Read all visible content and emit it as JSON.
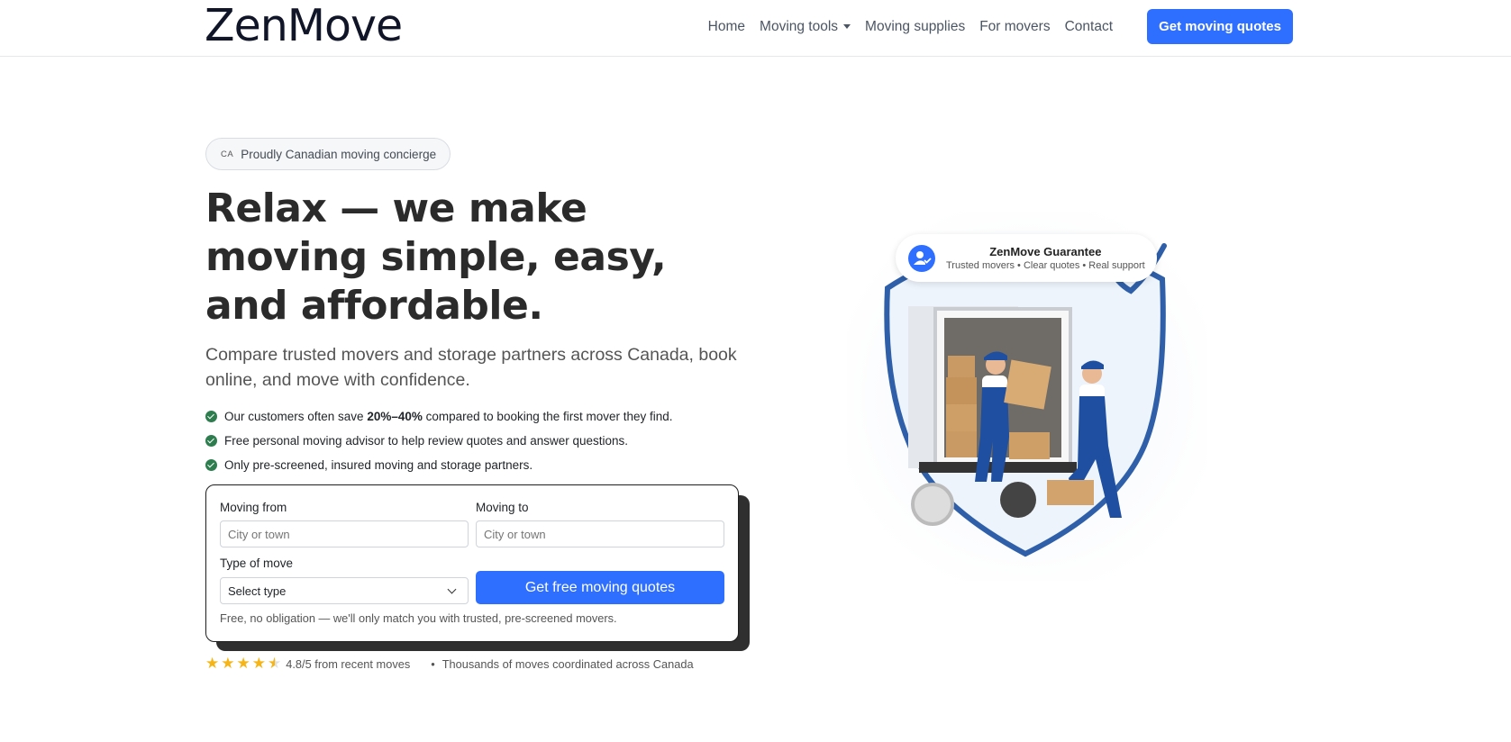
{
  "brand": {
    "name": "ZenMove"
  },
  "nav": {
    "items": [
      {
        "label": "Home"
      },
      {
        "label": "Moving tools",
        "has_dropdown": true
      },
      {
        "label": "Moving supplies"
      },
      {
        "label": "For movers"
      },
      {
        "label": "Contact"
      }
    ],
    "cta_label": "Get moving quotes"
  },
  "hero": {
    "badge_flag": "CA",
    "badge_text": "Proudly Canadian moving concierge",
    "title": "Relax — we make moving simple, easy, and affordable.",
    "subtitle": "Compare trusted movers and storage partners across Canada, book online, and move with confidence.",
    "benefits": {
      "b1_pre": "Our customers often save ",
      "b1_bold": "20%–40%",
      "b1_post": " compared to booking the first mover they find.",
      "b2": "Free personal moving advisor to help review quotes and answer questions.",
      "b3": "Only pre-screened, insured moving and storage partners."
    }
  },
  "form": {
    "from_label": "Moving from",
    "from_placeholder": "City or town",
    "to_label": "Moving to",
    "to_placeholder": "City or town",
    "type_label": "Type of move",
    "type_selected": "Select type",
    "submit_label": "Get free moving quotes",
    "note": "Free, no obligation — we'll only match you with trusted, pre-screened movers."
  },
  "rating": {
    "score_stars": 4.8,
    "text": "4.8/5 from recent moves",
    "separator": "•",
    "moves_text": "Thousands of moves coordinated across Canada"
  },
  "guarantee": {
    "title": "ZenMove Guarantee",
    "subtitle": "Trusted movers • Clear quotes • Real support"
  },
  "colors": {
    "primary": "#2f6fff",
    "check": "#2e7d4f",
    "star": "#f6b516",
    "shield": "#2f5fa8"
  }
}
